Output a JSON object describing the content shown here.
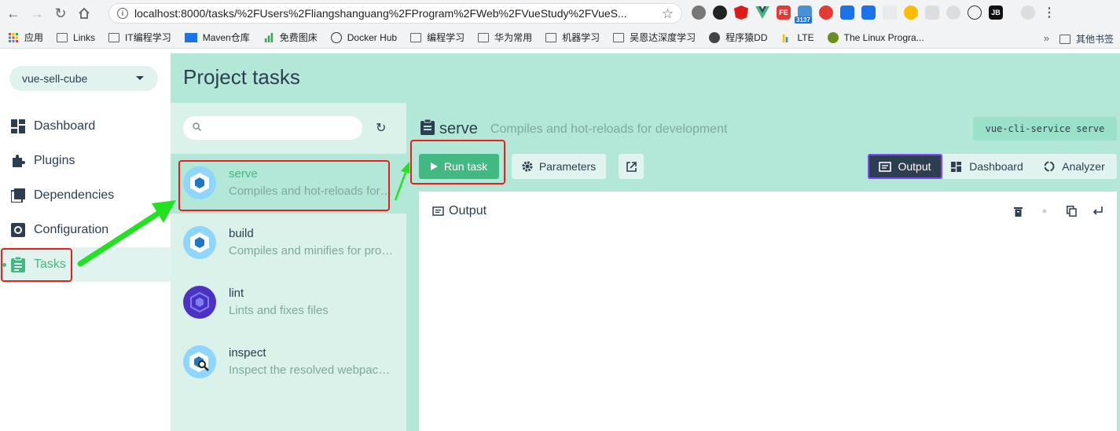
{
  "browser": {
    "url": "localhost:8000/tasks/%2FUsers%2Fliangshanguang%2FProgram%2FWeb%2FVueStudy%2FVueS...",
    "extension_badge": "3137",
    "extension_fe": "FE",
    "extension_jb": "JB",
    "bookmarks": [
      {
        "label": "应用",
        "icon": "apps-grid-icon"
      },
      {
        "label": "Links",
        "icon": "folder-icon"
      },
      {
        "label": "IT编程学习",
        "icon": "folder-icon"
      },
      {
        "label": "Maven仓库",
        "icon": "maven-icon"
      },
      {
        "label": "免费图床",
        "icon": "chart-icon"
      },
      {
        "label": "Docker Hub",
        "icon": "docker-icon"
      },
      {
        "label": "编程学习",
        "icon": "folder-icon"
      },
      {
        "label": "华为常用",
        "icon": "folder-icon"
      },
      {
        "label": "机器学习",
        "icon": "folder-icon"
      },
      {
        "label": "吴恩达深度学习",
        "icon": "folder-icon"
      },
      {
        "label": "程序猿DD",
        "icon": "avatar-icon"
      },
      {
        "label": "LTE",
        "icon": "chart-icon"
      },
      {
        "label": "The Linux Progra...",
        "icon": "linux-icon"
      }
    ],
    "bookmarks_more": "»",
    "other_bookmarks": "其他书签"
  },
  "sidebar": {
    "project": "vue-sell-cube",
    "items": [
      {
        "label": "Dashboard",
        "icon": "dashboard-icon"
      },
      {
        "label": "Plugins",
        "icon": "puzzle-icon"
      },
      {
        "label": "Dependencies",
        "icon": "dependencies-icon"
      },
      {
        "label": "Configuration",
        "icon": "gear-icon"
      },
      {
        "label": "Tasks",
        "icon": "clipboard-icon"
      }
    ],
    "active": "Tasks"
  },
  "header": {
    "title": "Project tasks"
  },
  "tasks": [
    {
      "name": "serve",
      "desc": "Compiles and hot-reloads for development",
      "icon": "webpack-icon"
    },
    {
      "name": "build",
      "desc": "Compiles and minifies for production",
      "icon": "webpack-icon"
    },
    {
      "name": "lint",
      "desc": "Lints and fixes files",
      "icon": "eslint-icon"
    },
    {
      "name": "inspect",
      "desc": "Inspect the resolved webpack config",
      "icon": "webpack-inspect-icon"
    }
  ],
  "details": {
    "name": "serve",
    "desc": "Compiles and hot-reloads for development",
    "command": "vue-cli-service serve",
    "run_label": "Run task",
    "params_label": "Parameters",
    "views": {
      "output": "Output",
      "dashboard": "Dashboard",
      "analyzer": "Analyzer"
    },
    "output_title": "Output"
  },
  "colors": {
    "accent": "#42b983",
    "header_bg": "#b3e8d8",
    "annotation": "#ea1e1e",
    "arrow": "#22e022"
  }
}
